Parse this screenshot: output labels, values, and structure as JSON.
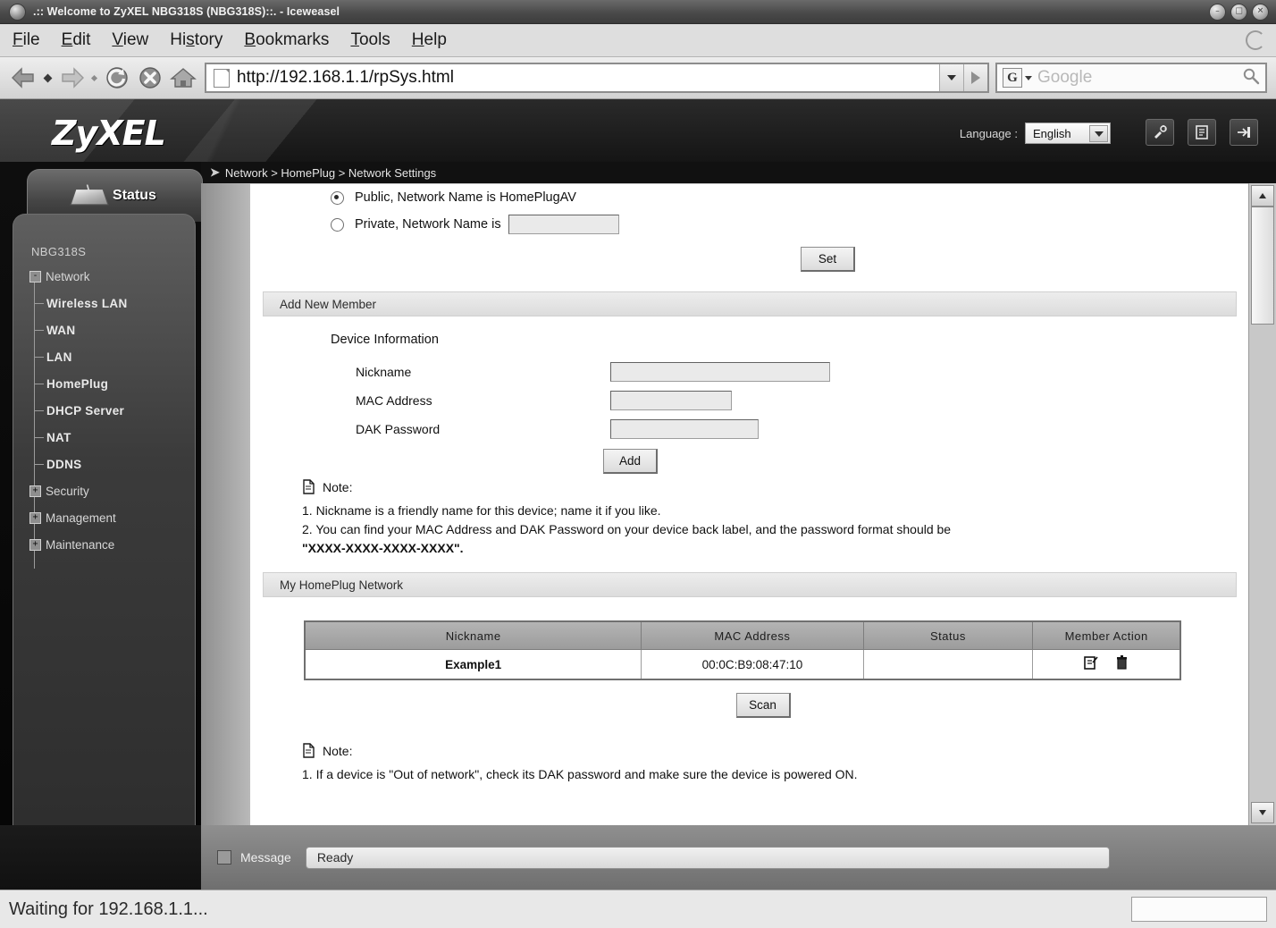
{
  "browser": {
    "title": ".:: Welcome to ZyXEL NBG318S (NBG318S)::. - Iceweasel",
    "window_buttons": [
      "minimize-button",
      "maximize-button",
      "close-button"
    ],
    "menus": [
      "File",
      "Edit",
      "View",
      "History",
      "Bookmarks",
      "Tools",
      "Help"
    ],
    "nav": {
      "back": "Back",
      "forward": "Forward",
      "reload": "Reload",
      "stop": "Stop",
      "home": "Home"
    },
    "url": "http://192.168.1.1/rpSys.html",
    "search_placeholder": "Google",
    "search_engine": "G",
    "status": "Waiting for 192.168.1.1..."
  },
  "router": {
    "logo": "ZyXEL",
    "language_label": "Language :",
    "language_value": "English",
    "header_icons": [
      "wizard-icon",
      "status-report-icon",
      "logout-icon"
    ],
    "breadcrumb": "Network > HomePlug > Network Settings",
    "sidebar": {
      "status_tab": "Status",
      "root": "NBG318S",
      "nodes": [
        {
          "label": "Network",
          "expander": "-",
          "children": [
            "Wireless LAN",
            "WAN",
            "LAN",
            "HomePlug",
            "DHCP Server",
            "NAT",
            "DDNS"
          ]
        },
        {
          "label": "Security",
          "expander": "+",
          "children": []
        },
        {
          "label": "Management",
          "expander": "+",
          "children": []
        },
        {
          "label": "Maintenance",
          "expander": "+",
          "children": []
        }
      ]
    },
    "network_name": {
      "public_label": "Public, Network Name is HomePlugAV",
      "private_label": "Private, Network Name is",
      "private_value": "",
      "set_button": "Set"
    },
    "add_member": {
      "section_title": "Add New Member",
      "device_info_title": "Device Information",
      "fields": [
        {
          "label": "Nickname",
          "value": ""
        },
        {
          "label": "MAC Address",
          "value": ""
        },
        {
          "label": "DAK Password",
          "value": ""
        }
      ],
      "add_button": "Add",
      "note_title": "Note:",
      "notes": [
        "1. Nickname is a friendly name for this device; name it if you like.",
        "2. You can find your MAC Address and DAK Password on your device back label, and the password format should be",
        "\"XXXX-XXXX-XXXX-XXXX\"."
      ]
    },
    "my_network": {
      "section_title": "My HomePlug Network",
      "columns": [
        "Nickname",
        "MAC Address",
        "Status",
        "Member Action"
      ],
      "rows": [
        {
          "nickname": "Example1",
          "mac": "00:0C:B9:08:47:10",
          "status": "",
          "actions": [
            "edit-icon",
            "delete-icon"
          ]
        }
      ],
      "scan_button": "Scan",
      "note_title": "Note:",
      "notes": [
        "1. If a device is \"Out of network\", check its DAK password and make sure the device is powered ON."
      ]
    },
    "message_bar": {
      "label": "Message",
      "value": "Ready"
    }
  }
}
